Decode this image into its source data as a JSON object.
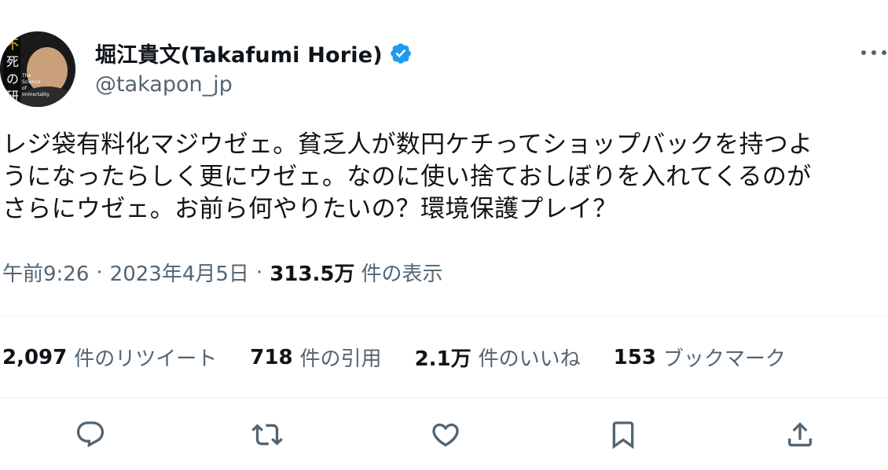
{
  "author": {
    "display_name": "堀江貴文(Takafumi Horie)",
    "handle": "@takapon_jp",
    "verified": true,
    "avatar_icon": "profile-photo",
    "avatar_text": "不死の研究 The Science of Immortality"
  },
  "tweet": {
    "text": "レジ袋有料化マジウゼェ。貧乏人が数円ケチってショップバックを持つよ\nうになったらしく更にウゼェ。なのに使い捨ておしぼりを入れてくるのが\nさらにウゼェ。お前ら何やりたいの？環境保護プレイ？",
    "time": "午前9:26",
    "separator": "·",
    "date": "2023年4月5日",
    "views_count": "313.5万",
    "views_label": "件の表示"
  },
  "stats": {
    "retweets": {
      "count": "2,097",
      "label": "件のリツイート"
    },
    "quotes": {
      "count": "718",
      "label": "件の引用"
    },
    "likes": {
      "count": "2.1万",
      "label": "件のいいね"
    },
    "bookmarks": {
      "count": "153",
      "label": "ブックマーク"
    }
  },
  "actions": [
    "reply-icon",
    "retweet-icon",
    "like-icon",
    "bookmark-icon",
    "share-icon"
  ],
  "colors": {
    "text_primary": "#0f1419",
    "text_secondary": "#536471",
    "verified_badge": "#1d9bf0",
    "divider": "#eff3f4"
  }
}
